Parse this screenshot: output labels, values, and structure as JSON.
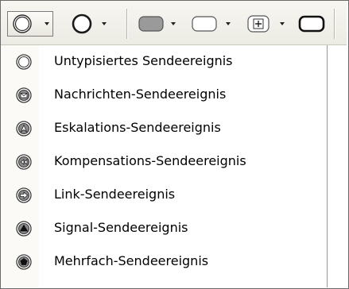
{
  "toolbar": {
    "buttons": [
      {
        "icon": "event-circle-thin-icon"
      },
      {
        "icon": "event-circle-bold-icon"
      },
      {
        "icon": "task-rounded-gray-icon"
      },
      {
        "icon": "task-rounded-white-icon"
      },
      {
        "icon": "subprocess-plus-icon"
      },
      {
        "icon": "task-rounded-bold-icon"
      }
    ]
  },
  "menu": {
    "items": [
      {
        "label": "Untypisiertes Sendeereignis",
        "icon": "untyped-send-event-icon"
      },
      {
        "label": "Nachrichten-Sendeereignis",
        "icon": "message-send-event-icon"
      },
      {
        "label": "Eskalations-Sendeereignis",
        "icon": "escalation-send-event-icon"
      },
      {
        "label": "Kompensations-Sendeereignis",
        "icon": "compensation-send-event-icon"
      },
      {
        "label": "Link-Sendeereignis",
        "icon": "link-send-event-icon"
      },
      {
        "label": "Signal-Sendeereignis",
        "icon": "signal-send-event-icon"
      },
      {
        "label": "Mehrfach-Sendeereignis",
        "icon": "multiple-send-event-icon"
      }
    ]
  },
  "colors": {
    "toolbar_bg": "#ecebe4",
    "icon_dark": "#3a3a3a",
    "icon_fill": "#8a8a8a"
  }
}
